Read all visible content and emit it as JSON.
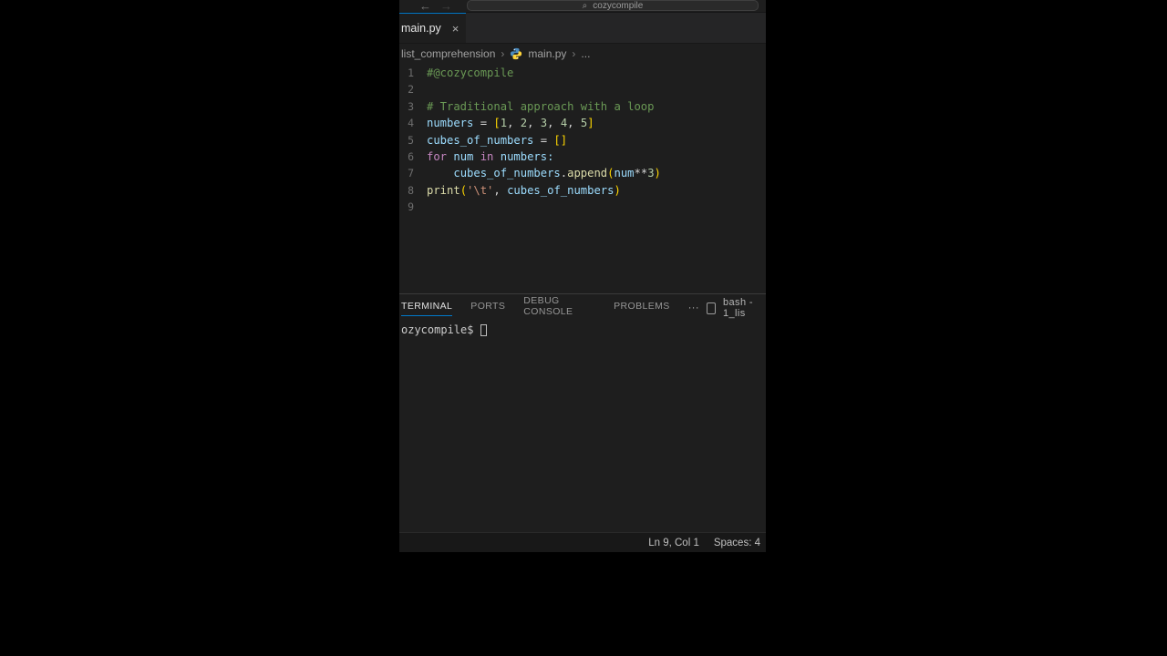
{
  "search": {
    "placeholder": "cozycompile"
  },
  "tab": {
    "label": "main.py"
  },
  "breadcrumbs": {
    "folder": "list_comprehension",
    "file": "main.py",
    "tail": "..."
  },
  "code_lines": [
    "1",
    "2",
    "3",
    "4",
    "5",
    "6",
    "7",
    "8",
    "9"
  ],
  "code": {
    "l1_comment": "#@cozycompile",
    "l3_comment": "# Traditional approach with a loop",
    "l4_var": "numbers",
    "l4_rest": " = [1, 2, 3, 4, 5]",
    "l5_var": "cubes_of_numbers",
    "l5_rest": " = []",
    "l6_for": "for",
    "l6_num": " num ",
    "l6_in": "in",
    "l6_numbers": " numbers:",
    "l7_indent": "    ",
    "l7_var": "cubes_of_numbers",
    "l7_dot": ".",
    "l7_append": "append",
    "l7_open": "(",
    "l7_arg": "num",
    "l7_pow": "**",
    "l7_three": "3",
    "l7_close": ")",
    "l8_print": "print",
    "l8_open": "(",
    "l8_str": "'\\t'",
    "l8_comma": ", ",
    "l8_var": "cubes_of_numbers",
    "l8_close": ")"
  },
  "panel": {
    "tabs": {
      "terminal": "TERMINAL",
      "ports": "PORTS",
      "debug": "DEBUG CONSOLE",
      "problems": "PROBLEMS"
    },
    "more": "···",
    "shell_label": "bash - 1_lis",
    "prompt": "ozycompile$ "
  },
  "status": {
    "cursor": "Ln 9, Col 1",
    "spaces": "Spaces: 4"
  }
}
